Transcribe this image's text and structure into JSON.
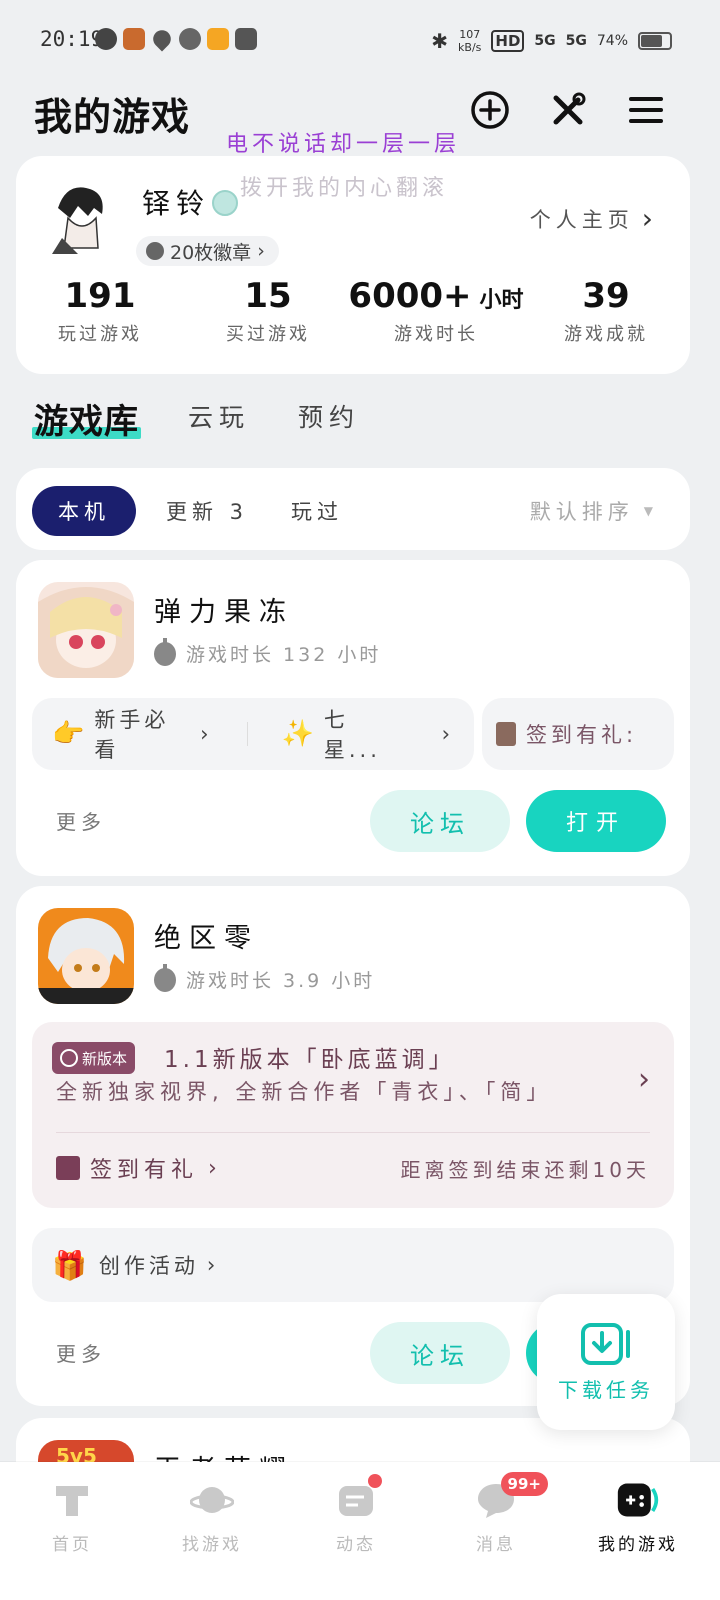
{
  "status_bar": {
    "time": "20:19",
    "net_speed": "107",
    "net_unit": "kB/s",
    "hd": "HD",
    "signal1": "5G",
    "signal2": "5G",
    "battery": "74%",
    "battery_level": 0.74
  },
  "header": {
    "title": "我的游戏",
    "overlay_line1": "电不说话却一层一层",
    "overlay_line2": "拨开我的内心翻滚",
    "overlay_line1_color": "#9a3fd4",
    "overlay_line2_color": "#c9c3cc"
  },
  "profile": {
    "username": "铎铃",
    "medals": "20枚徽章",
    "homepage_link": "个人主页",
    "stats": [
      {
        "value": "191",
        "unit": "",
        "label": "玩过游戏"
      },
      {
        "value": "15",
        "unit": "",
        "label": "买过游戏"
      },
      {
        "value": "6000+",
        "unit": "小时",
        "label": "游戏时长"
      },
      {
        "value": "39",
        "unit": "",
        "label": "游戏成就"
      }
    ]
  },
  "library_tabs": [
    "游戏库",
    "云玩",
    "预约"
  ],
  "filters": {
    "chips": [
      "本机",
      "更新 3",
      "玩过"
    ],
    "sort": "默认排序"
  },
  "games": [
    {
      "name": "弹力果冻",
      "playtime": "游戏时长 132 小时",
      "pills": [
        "新手必看",
        "七星...",
        "签到有礼:"
      ],
      "more": "更多",
      "forum": "论坛",
      "open": "打开"
    },
    {
      "name": "绝区零",
      "playtime": "游戏时长 3.9 小时",
      "news_tag": "新版本",
      "news_title": "1.1新版本「卧底蓝调」",
      "news_sub": "全新独家视界, 全新合作者「青衣」、「简」",
      "sign_in": "签到有礼",
      "sign_remaining": "距离签到结束还剩10天",
      "activity": "创作活动",
      "more": "更多",
      "forum": "论坛"
    },
    {
      "name": "王者荣耀",
      "icon_text": "5v5"
    }
  ],
  "download_task": "下载任务",
  "bottom_nav": [
    {
      "label": "首页"
    },
    {
      "label": "找游戏"
    },
    {
      "label": "动态"
    },
    {
      "label": "消息",
      "badge": "99+"
    },
    {
      "label": "我的游戏"
    }
  ],
  "colors": {
    "accent": "#18d4c0",
    "chip_active": "#1b1f6e",
    "badge_red": "#f0525a"
  }
}
